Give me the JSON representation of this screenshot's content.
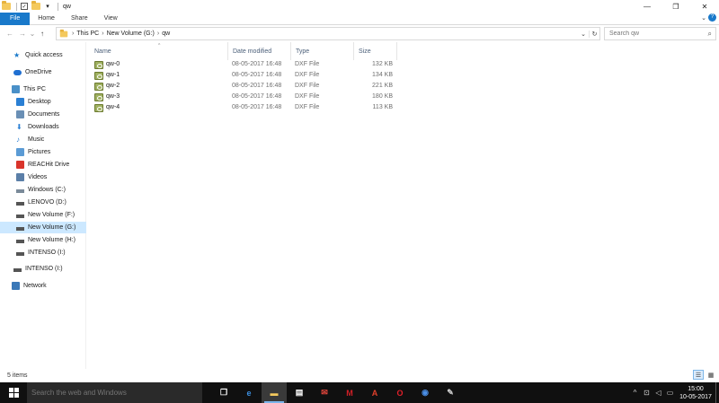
{
  "window": {
    "title": "qw",
    "controls": {
      "minimize": "—",
      "maximize": "❐",
      "close": "✕"
    }
  },
  "quick_access_toolbar": {
    "dropdown": "▾"
  },
  "ribbon": {
    "tabs": [
      "File",
      "Home",
      "Share",
      "View"
    ],
    "expand": "⌄",
    "help": "?"
  },
  "nav": {
    "back": "←",
    "forward": "→",
    "recent": "⌄",
    "up": "↑"
  },
  "address": {
    "crumbs": [
      "This PC",
      "New Volume (G:)",
      "qw"
    ],
    "separator": "›",
    "dropdown": "⌄",
    "refresh": "↻"
  },
  "search": {
    "placeholder": "Search qw",
    "icon": "⌕"
  },
  "sidebar": {
    "items": [
      {
        "label": "Quick access",
        "icon": "star-icon",
        "color": "#1979ca"
      },
      {
        "label": "OneDrive",
        "icon": "cloud-icon",
        "color": "#1f6fd1"
      },
      {
        "label": "This PC",
        "icon": "computer-icon",
        "color": "#4a90c8"
      },
      {
        "label": "Desktop",
        "icon": "desktop-icon",
        "color": "#2a7fd4"
      },
      {
        "label": "Documents",
        "icon": "documents-icon",
        "color": "#6a8fb5"
      },
      {
        "label": "Downloads",
        "icon": "download-icon",
        "color": "#2a7fd4"
      },
      {
        "label": "Music",
        "icon": "music-icon",
        "color": "#2a7fd4"
      },
      {
        "label": "Pictures",
        "icon": "pictures-icon",
        "color": "#5b9bd5"
      },
      {
        "label": "REACHit Drive",
        "icon": "reachit-icon",
        "color": "#d9342b"
      },
      {
        "label": "Videos",
        "icon": "videos-icon",
        "color": "#5b7fa8"
      },
      {
        "label": "Windows (C:)",
        "icon": "drive-c-icon",
        "color": "#7a8a99"
      },
      {
        "label": "LENOVO (D:)",
        "icon": "drive-icon",
        "color": "#555555"
      },
      {
        "label": "New Volume (F:)",
        "icon": "drive-icon",
        "color": "#555555"
      },
      {
        "label": "New Volume (G:)",
        "icon": "drive-icon",
        "color": "#555555",
        "selected": true
      },
      {
        "label": "New Volume (H:)",
        "icon": "drive-icon",
        "color": "#555555"
      },
      {
        "label": "INTENSO (I:)",
        "icon": "drive-icon",
        "color": "#555555"
      },
      {
        "label": "INTENSO (I:)",
        "icon": "usb-drive-icon",
        "color": "#555555"
      },
      {
        "label": "Network",
        "icon": "network-icon",
        "color": "#3a78b8"
      }
    ]
  },
  "columns": [
    "Name",
    "Date modified",
    "Type",
    "Size"
  ],
  "sort_indicator": "^",
  "files": [
    {
      "name": "qw-0",
      "date": "08-05-2017 16:48",
      "type": "DXF File",
      "size": "132 KB"
    },
    {
      "name": "qw-1",
      "date": "08-05-2017 16:48",
      "type": "DXF File",
      "size": "134 KB"
    },
    {
      "name": "qw-2",
      "date": "08-05-2017 16:48",
      "type": "DXF File",
      "size": "221 KB"
    },
    {
      "name": "qw-3",
      "date": "08-05-2017 16:48",
      "type": "DXF File",
      "size": "180 KB"
    },
    {
      "name": "qw-4",
      "date": "08-05-2017 16:48",
      "type": "DXF File",
      "size": "113 KB"
    }
  ],
  "status": {
    "items_count": "5 items"
  },
  "view_buttons": {
    "details": "☰",
    "large_icons": "▦"
  },
  "taskbar": {
    "search_placeholder": "Search the web and Windows",
    "apps": [
      {
        "name": "task-view",
        "glyph": "❐",
        "color": "#ffffff"
      },
      {
        "name": "edge",
        "glyph": "e",
        "color": "#3c8fe0"
      },
      {
        "name": "file-explorer",
        "glyph": "▬",
        "color": "#f4c95d",
        "active": true
      },
      {
        "name": "store",
        "glyph": "▤",
        "color": "#ffffff"
      },
      {
        "name": "mail",
        "glyph": "✉",
        "color": "#e8473d"
      },
      {
        "name": "mcafee",
        "glyph": "M",
        "color": "#d01f26"
      },
      {
        "name": "acrobat",
        "glyph": "A",
        "color": "#e0402b"
      },
      {
        "name": "opera",
        "glyph": "O",
        "color": "#e0202a"
      },
      {
        "name": "chrome",
        "glyph": "◉",
        "color": "#4a8fe6"
      },
      {
        "name": "paint",
        "glyph": "✎",
        "color": "#cfcfcf"
      }
    ],
    "tray": {
      "up": "^",
      "network": "⊡",
      "volume": "◁",
      "message": "▭"
    },
    "time": "15:00",
    "date": "10-05-2017"
  }
}
